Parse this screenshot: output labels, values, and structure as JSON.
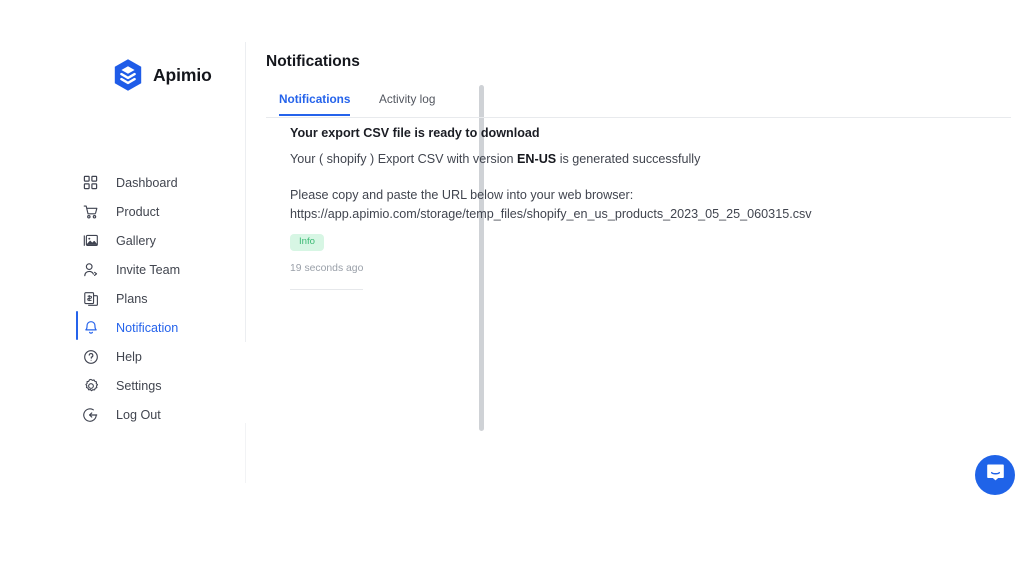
{
  "brand": {
    "name": "Apimio",
    "logo_icon": "apimio-hexagon-layers-logo",
    "accent_color": "#1f5ce8"
  },
  "sidebar": {
    "items": [
      {
        "label": "Dashboard",
        "icon": "grid-icon",
        "active": false
      },
      {
        "label": "Product",
        "icon": "cart-icon",
        "active": false
      },
      {
        "label": "Gallery",
        "icon": "image-icon",
        "active": false
      },
      {
        "label": "Invite Team",
        "icon": "user-plus-icon",
        "active": false
      },
      {
        "label": "Plans",
        "icon": "billing-icon",
        "active": false
      },
      {
        "label": "Notification",
        "icon": "bell-icon",
        "active": true
      },
      {
        "label": "Help",
        "icon": "question-circle-icon",
        "active": false
      },
      {
        "label": "Settings",
        "icon": "gear-icon",
        "active": false
      },
      {
        "label": "Log Out",
        "icon": "logout-icon",
        "active": false
      }
    ]
  },
  "header": {
    "title": "Notifications"
  },
  "tabs": [
    {
      "label": "Notifications",
      "active": true
    },
    {
      "label": "Activity log",
      "active": false
    }
  ],
  "notification": {
    "title": "Your export CSV file is ready to download",
    "subtitle_prefix": "Your ( shopify ) Export CSV with version ",
    "subtitle_strong": "EN-US",
    "subtitle_suffix": " is generated successfully",
    "instruction": "Please copy and paste the URL below into your web browser:",
    "url": "https://app.apimio.com/storage/temp_files/shopify_en_us_products_2023_05_25_060315.csv",
    "badge_label": "Info",
    "badge_bg": "#d7f6e4",
    "badge_color": "#3cba74",
    "timestamp": "19 seconds ago"
  },
  "chat_widget": {
    "icon": "intercom-messenger-icon",
    "color": "#1f63e8"
  }
}
